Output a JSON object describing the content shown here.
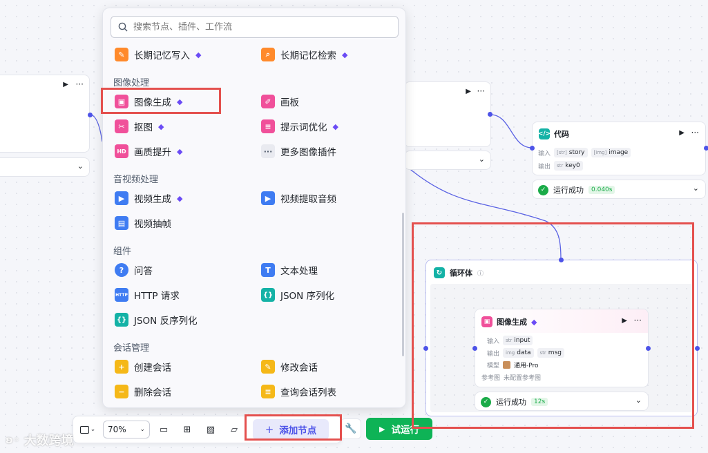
{
  "search": {
    "placeholder": "搜索节点、插件、工作流"
  },
  "menu": {
    "top_items": [
      {
        "label": "长期记忆写入",
        "icon": "memory-write-icon",
        "color": "#ff8a2b",
        "premium": true
      },
      {
        "label": "长期记忆检索",
        "icon": "memory-search-icon",
        "color": "#ff8a2b",
        "premium": true
      }
    ],
    "sections": [
      {
        "title": "图像处理",
        "items": [
          {
            "label": "图像生成",
            "icon": "image-generate-icon",
            "color": "#f0509a",
            "premium": true
          },
          {
            "label": "画板",
            "icon": "canvas-icon",
            "color": "#f0509a",
            "premium": false
          },
          {
            "label": "抠图",
            "icon": "cutout-icon",
            "color": "#f0509a",
            "premium": true
          },
          {
            "label": "提示词优化",
            "icon": "prompt-optimize-icon",
            "color": "#f0509a",
            "premium": true
          },
          {
            "label": "画质提升",
            "icon": "hd-icon",
            "color": "#f0509a",
            "premium": true
          },
          {
            "label": "更多图像插件",
            "icon": "more-icon",
            "color": "#e9eaf0",
            "premium": false
          }
        ]
      },
      {
        "title": "音视频处理",
        "items": [
          {
            "label": "视频生成",
            "icon": "video-generate-icon",
            "color": "#3f7cf2",
            "premium": true
          },
          {
            "label": "视频提取音频",
            "icon": "video-audio-icon",
            "color": "#3f7cf2",
            "premium": false
          },
          {
            "label": "视频抽帧",
            "icon": "video-frame-icon",
            "color": "#3f7cf2",
            "premium": false
          }
        ]
      },
      {
        "title": "组件",
        "items": [
          {
            "label": "问答",
            "icon": "qa-icon",
            "color": "#3f7cf2",
            "premium": false
          },
          {
            "label": "文本处理",
            "icon": "text-process-icon",
            "color": "#3f7cf2",
            "premium": false
          },
          {
            "label": "HTTP 请求",
            "icon": "http-icon",
            "color": "#3f7cf2",
            "premium": false
          },
          {
            "label": "JSON 序列化",
            "icon": "json-serialize-icon",
            "color": "#14b2a6",
            "premium": false
          },
          {
            "label": "JSON 反序列化",
            "icon": "json-deserialize-icon",
            "color": "#14b2a6",
            "premium": false
          }
        ]
      },
      {
        "title": "会话管理",
        "items": [
          {
            "label": "创建会话",
            "icon": "create-session-icon",
            "color": "#f5b818",
            "premium": false
          },
          {
            "label": "修改会话",
            "icon": "edit-session-icon",
            "color": "#f5b818",
            "premium": false
          },
          {
            "label": "删除会话",
            "icon": "delete-session-icon",
            "color": "#f5b818",
            "premium": false
          },
          {
            "label": "查询会话列表",
            "icon": "list-session-icon",
            "color": "#f5b818",
            "premium": false
          }
        ]
      }
    ]
  },
  "code_node": {
    "title": "代码",
    "input_label": "输入",
    "inputs": [
      {
        "type": "[str]",
        "name": "story"
      },
      {
        "type": "[img]",
        "name": "image"
      }
    ],
    "output_label": "输出",
    "outputs": [
      {
        "type": "str",
        "name": "key0"
      }
    ],
    "status": "运行成功",
    "time": "0.040s"
  },
  "loop_node": {
    "title": "循环体"
  },
  "image_node": {
    "title": "图像生成",
    "input_label": "输入",
    "input": {
      "type": "str",
      "name": "input"
    },
    "output_label": "输出",
    "outputs": [
      {
        "type": "img",
        "name": "data"
      },
      {
        "type": "str",
        "name": "msg"
      }
    ],
    "model_label": "模型",
    "model": "通用-Pro",
    "ref_label": "参考图",
    "ref_value": "未配置参考图",
    "status": "运行成功",
    "time": "12s"
  },
  "toolbar": {
    "zoom": "70%",
    "add_node": "添加节点",
    "try_run": "试运行"
  },
  "watermark": "大数跨境",
  "colors": {
    "accent": "#4d53e8",
    "success": "#1aab48",
    "highlight": "#e4504e",
    "run_green": "#0eb356"
  }
}
